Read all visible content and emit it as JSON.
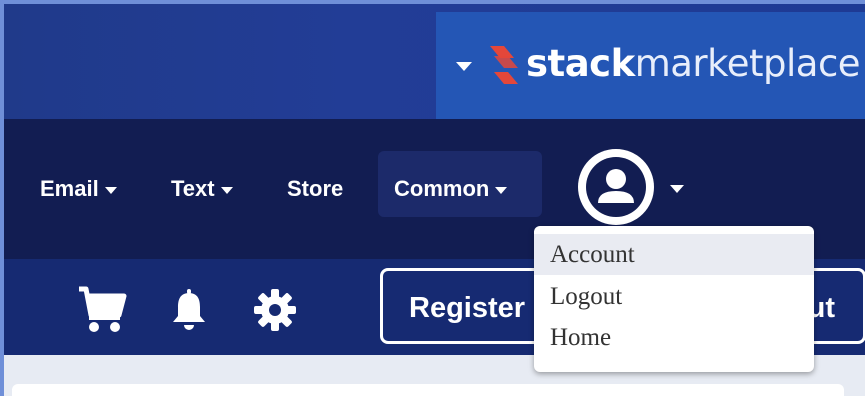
{
  "brand": {
    "name_bold": "stack",
    "name_light": "marketplace",
    "logo_color": "#e4473a"
  },
  "nav": {
    "items": [
      {
        "label": "Email",
        "has_caret": true
      },
      {
        "label": "Text",
        "has_caret": true
      },
      {
        "label": "Store",
        "has_caret": false
      },
      {
        "label": "Common",
        "has_caret": true
      }
    ],
    "user_icon": "user-avatar-icon"
  },
  "toolbar": {
    "icons": [
      "cart-icon",
      "bell-icon",
      "gear-icon"
    ],
    "register_label": "Register",
    "logout_partial": "ut"
  },
  "user_menu": {
    "items": [
      {
        "label": "Account",
        "active": true
      },
      {
        "label": "Logout",
        "active": false
      },
      {
        "label": "Home",
        "active": false
      }
    ]
  }
}
